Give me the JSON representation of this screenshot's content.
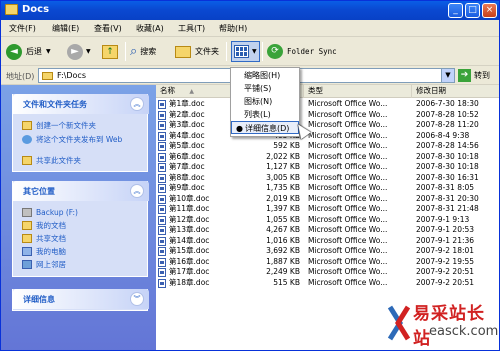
{
  "window": {
    "title": "Docs"
  },
  "menubar": {
    "items": [
      "文件(F)",
      "编辑(E)",
      "查看(V)",
      "收藏(A)",
      "工具(T)",
      "帮助(H)"
    ]
  },
  "toolbar": {
    "back": "后退",
    "search": "搜索",
    "folders": "文件夹",
    "folder_sync": "Folder Sync"
  },
  "address": {
    "label": "地址(D)",
    "value": "F:\\Docs",
    "go": "转到"
  },
  "tasks": {
    "title": "文件和文件夹任务",
    "items": [
      "创建一个新文件夹",
      "将这个文件夹发布到 Web",
      "共享此文件夹"
    ]
  },
  "places": {
    "title": "其它位置",
    "items": [
      "Backup (F:)",
      "我的文档",
      "共享文档",
      "我的电脑",
      "网上邻居"
    ]
  },
  "details": {
    "title": "详细信息"
  },
  "columns": {
    "name": "名称",
    "size": "大小",
    "type": "类型",
    "modified": "修改日期"
  },
  "files": [
    {
      "name": "第1章.doc",
      "size": "",
      "type": "Microsoft Office Wo...",
      "modified": "2006-7-30 18:30"
    },
    {
      "name": "第2章.doc",
      "size": "",
      "type": "Microsoft Office Wo...",
      "modified": "2007-8-28 10:52"
    },
    {
      "name": "第3章.doc",
      "size": "",
      "type": "Microsoft Office Wo...",
      "modified": "2007-8-28 11:20"
    },
    {
      "name": "第4章.doc",
      "size": "405 KB",
      "type": "Microsoft Office Wo...",
      "modified": "2006-8-4 9:38"
    },
    {
      "name": "第5章.doc",
      "size": "592 KB",
      "type": "Microsoft Office Wo...",
      "modified": "2007-8-28 14:56"
    },
    {
      "name": "第6章.doc",
      "size": "2,022 KB",
      "type": "Microsoft Office Wo...",
      "modified": "2007-8-30 10:18"
    },
    {
      "name": "第7章.doc",
      "size": "1,127 KB",
      "type": "Microsoft Office Wo...",
      "modified": "2007-8-30 10:18"
    },
    {
      "name": "第8章.doc",
      "size": "3,005 KB",
      "type": "Microsoft Office Wo...",
      "modified": "2007-8-30 16:31"
    },
    {
      "name": "第9章.doc",
      "size": "1,735 KB",
      "type": "Microsoft Office Wo...",
      "modified": "2007-8-31 8:05"
    },
    {
      "name": "第10章.doc",
      "size": "2,019 KB",
      "type": "Microsoft Office Wo...",
      "modified": "2007-8-31 20:30"
    },
    {
      "name": "第11章.doc",
      "size": "1,397 KB",
      "type": "Microsoft Office Wo...",
      "modified": "2007-8-31 21:48"
    },
    {
      "name": "第12章.doc",
      "size": "1,055 KB",
      "type": "Microsoft Office Wo...",
      "modified": "2007-9-1 9:13"
    },
    {
      "name": "第13章.doc",
      "size": "4,267 KB",
      "type": "Microsoft Office Wo...",
      "modified": "2007-9-1 20:53"
    },
    {
      "name": "第14章.doc",
      "size": "1,016 KB",
      "type": "Microsoft Office Wo...",
      "modified": "2007-9-1 21:36"
    },
    {
      "name": "第15章.doc",
      "size": "3,692 KB",
      "type": "Microsoft Office Wo...",
      "modified": "2007-9-2 18:01"
    },
    {
      "name": "第16章.doc",
      "size": "1,887 KB",
      "type": "Microsoft Office Wo...",
      "modified": "2007-9-2 19:55"
    },
    {
      "name": "第17章.doc",
      "size": "2,249 KB",
      "type": "Microsoft Office Wo...",
      "modified": "2007-9-2 20:51"
    },
    {
      "name": "第18章.doc",
      "size": "515 KB",
      "type": "Microsoft Office Wo...",
      "modified": "2007-9-2 20:51"
    }
  ],
  "view_menu": {
    "items": [
      "缩略图(H)",
      "平铺(S)",
      "图标(N)",
      "列表(L)",
      "详细信息(D)"
    ],
    "selected": "详细信息(D)"
  },
  "watermark": {
    "text": "易采站长站",
    "url": "easck.com"
  }
}
